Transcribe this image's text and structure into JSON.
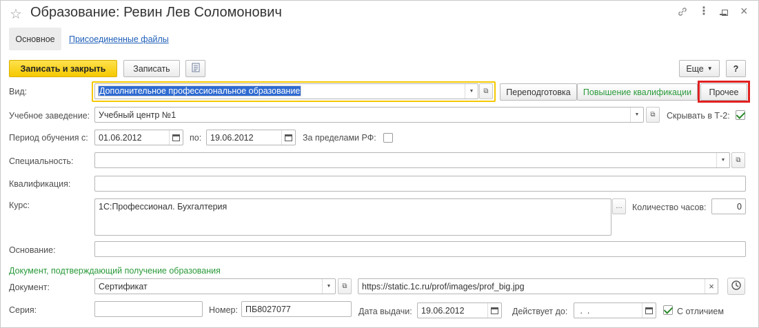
{
  "window": {
    "title": "Образование: Ревин Лев Соломонович"
  },
  "tabs": [
    {
      "label": "Основное"
    },
    {
      "label": "Присоединенные файлы"
    }
  ],
  "toolbar": {
    "save_close": "Записать и закрыть",
    "save": "Записать",
    "more": "Еще",
    "help": "?"
  },
  "vid": {
    "label": "Вид:",
    "value": "Дополнительное профессиональное образование",
    "quick": [
      "Переподготовка",
      "Повышение квалификации",
      "Прочее"
    ]
  },
  "institution": {
    "label": "Учебное заведение:",
    "value": "Учебный центр №1",
    "hide_label": "Скрывать в Т-2:"
  },
  "period": {
    "label": "Период обучения с:",
    "from": "01.06.2012",
    "to_label": "по:",
    "to": "19.06.2012",
    "abroad_label": "За пределами РФ:"
  },
  "specialty": {
    "label": "Специальность:",
    "value": ""
  },
  "qualification": {
    "label": "Квалификация:",
    "value": ""
  },
  "course": {
    "label": "Курс:",
    "value": "1С:Профессионал. Бухгалтерия",
    "hours_label": "Количество часов:",
    "hours": "0"
  },
  "basis": {
    "label": "Основание:",
    "value": ""
  },
  "doc_section": "Документ, подтверждающий получение образования",
  "document": {
    "label": "Документ:",
    "value": "Сертификат",
    "url": "https://static.1c.ru/prof/images/prof_big.jpg"
  },
  "series": {
    "label": "Серия:",
    "value": "",
    "number_label": "Номер:",
    "number": "ПБ8027077",
    "issue_label": "Дата выдачи:",
    "issue": "19.06.2012",
    "valid_label": "Действует до:",
    "valid": " .  .",
    "honors_label": "С отличием"
  }
}
